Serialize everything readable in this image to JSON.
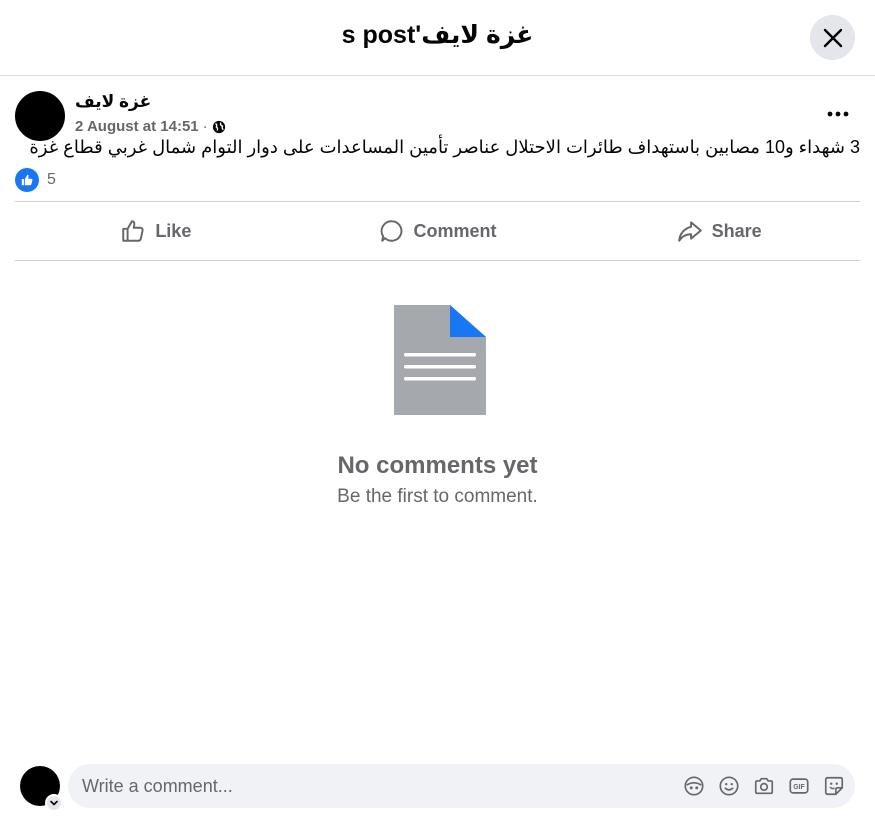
{
  "dialog": {
    "title": "غزة لايف's post"
  },
  "post": {
    "author_name": "غزة لايف",
    "date": "2 August at 14:51",
    "separator": "·",
    "audience_icon": "globe-icon",
    "text": "3 شهداء و10 مصابين باستهداف طائرات الاحتلال عناصر تأمين المساعدات على دوار التوام شمال غربي قطاع غزة",
    "reaction_count": "5",
    "reaction_icon": "like-reaction-icon"
  },
  "actions": {
    "like_label": "Like",
    "comment_label": "Comment",
    "share_label": "Share"
  },
  "comments": {
    "empty_title": "No comments yet",
    "empty_subtitle": "Be the first to comment."
  },
  "composer": {
    "placeholder": "Write a comment...",
    "icons": [
      "avatar-sticker-icon",
      "emoji-icon",
      "camera-icon",
      "gif-icon",
      "sticker-icon"
    ]
  },
  "colors": {
    "accent": "#1877f2",
    "secondary_text": "#65676b",
    "divider": "#ced0d4",
    "illustration_gray": "#a5a8ad"
  }
}
